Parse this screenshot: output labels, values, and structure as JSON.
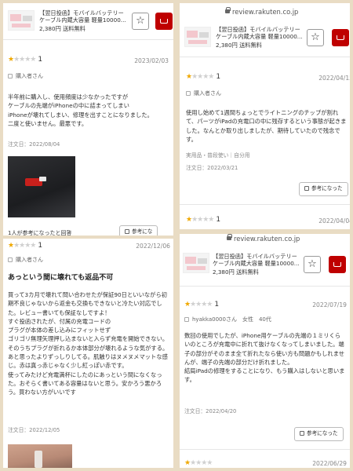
{
  "product": {
    "title": "【翌日投函】モバイルバッテリー ケーブル内蔵大容量 軽量10000...",
    "price": "2,380円",
    "shipping": "送料無料"
  },
  "site_url": "review.rakuten.co.jp",
  "helpful_label": "参考になった",
  "panels": [
    {
      "rating": "1",
      "date": "2023/02/03",
      "user": "購入者さん",
      "body": "半年前に購入し、使用頻度は少なかったですが\nケーブルの先端がiPhoneの中に詰まってしまい\niPhoneが壊れてしまい、修理を出すことになりました。\n二度と使いません。最悪です。",
      "order_date": "注文日：2022/08/04",
      "helpful_count": "1人が参考になったと回答",
      "helpful_button": "参考にな"
    },
    {
      "rating": "1",
      "date": "2022/04/15",
      "user": "購入者さん",
      "body": "使用し始めて1週間ちょっとでライトニングのチップが割れて、パーツがiPadの充電口の中に残存するという事態が起きました。なんとか取り出しましたが、期待していたので残念です。",
      "usage": "実用品・普段使い｜自分用",
      "order_date": "注文日：2022/03/21",
      "next_rating": "1",
      "next_date": "2022/04/04"
    },
    {
      "rating": "1",
      "date": "2022/12/06",
      "user": "購入者さん",
      "headline": "あっという間に壊れても返品不可",
      "body": "買って3カ月で壊れて問い合わせたが保証90日といいながら初期不良じゃないから返金も交換もできないと冷たい対応でした。レビュー書いても保証なしですよ！\nすぐ投函されたが、付属の充電コードの\nプラグが本体の差し込みにフィットせず\nゴリゴリ無理矢理押し込まないと入らず充電を開始できない。そのうちプラグが折れるか本体部分が壊れるような気がする。\nあと思ったよりずっしりしてる。肌触りはヌメヌメマットな感じ。赤は真っ赤じゃなく少し紅っぽい赤です。\n使ってみたけど充電満杯にしたのにあっという間になくなった。おそらく書いてある容量はないと思う。安かろう悪かろう。買わない方がいいです",
      "order_date": "注文日：2022/12/05"
    },
    {
      "rating": "1",
      "date": "2022/07/19",
      "user": "hyakka0000さん　女性　40代",
      "body": "数回の使用でしたが、iPhone用ケーブルの先端の１ミリくらいのところが充電中に折れて抜けなくなってしまいました。端子の部分がそのまま全て折れたなら使い方も問題かもしれませんが、端子の先端の部分だけ折れました。\n結局iPadの修理をすることになり、もう購入はしないと思います。",
      "order_date": "注文日：2022/04/20",
      "next_date": "2022/06/29"
    }
  ],
  "icons": [
    "lock-icon",
    "star-icon",
    "cart-icon",
    "user-icon",
    "thumbs-up-icon"
  ],
  "colors": {
    "brand_red": "#bf0000",
    "star_gold": "#f0a800",
    "star_gray": "#d0d0d0"
  }
}
